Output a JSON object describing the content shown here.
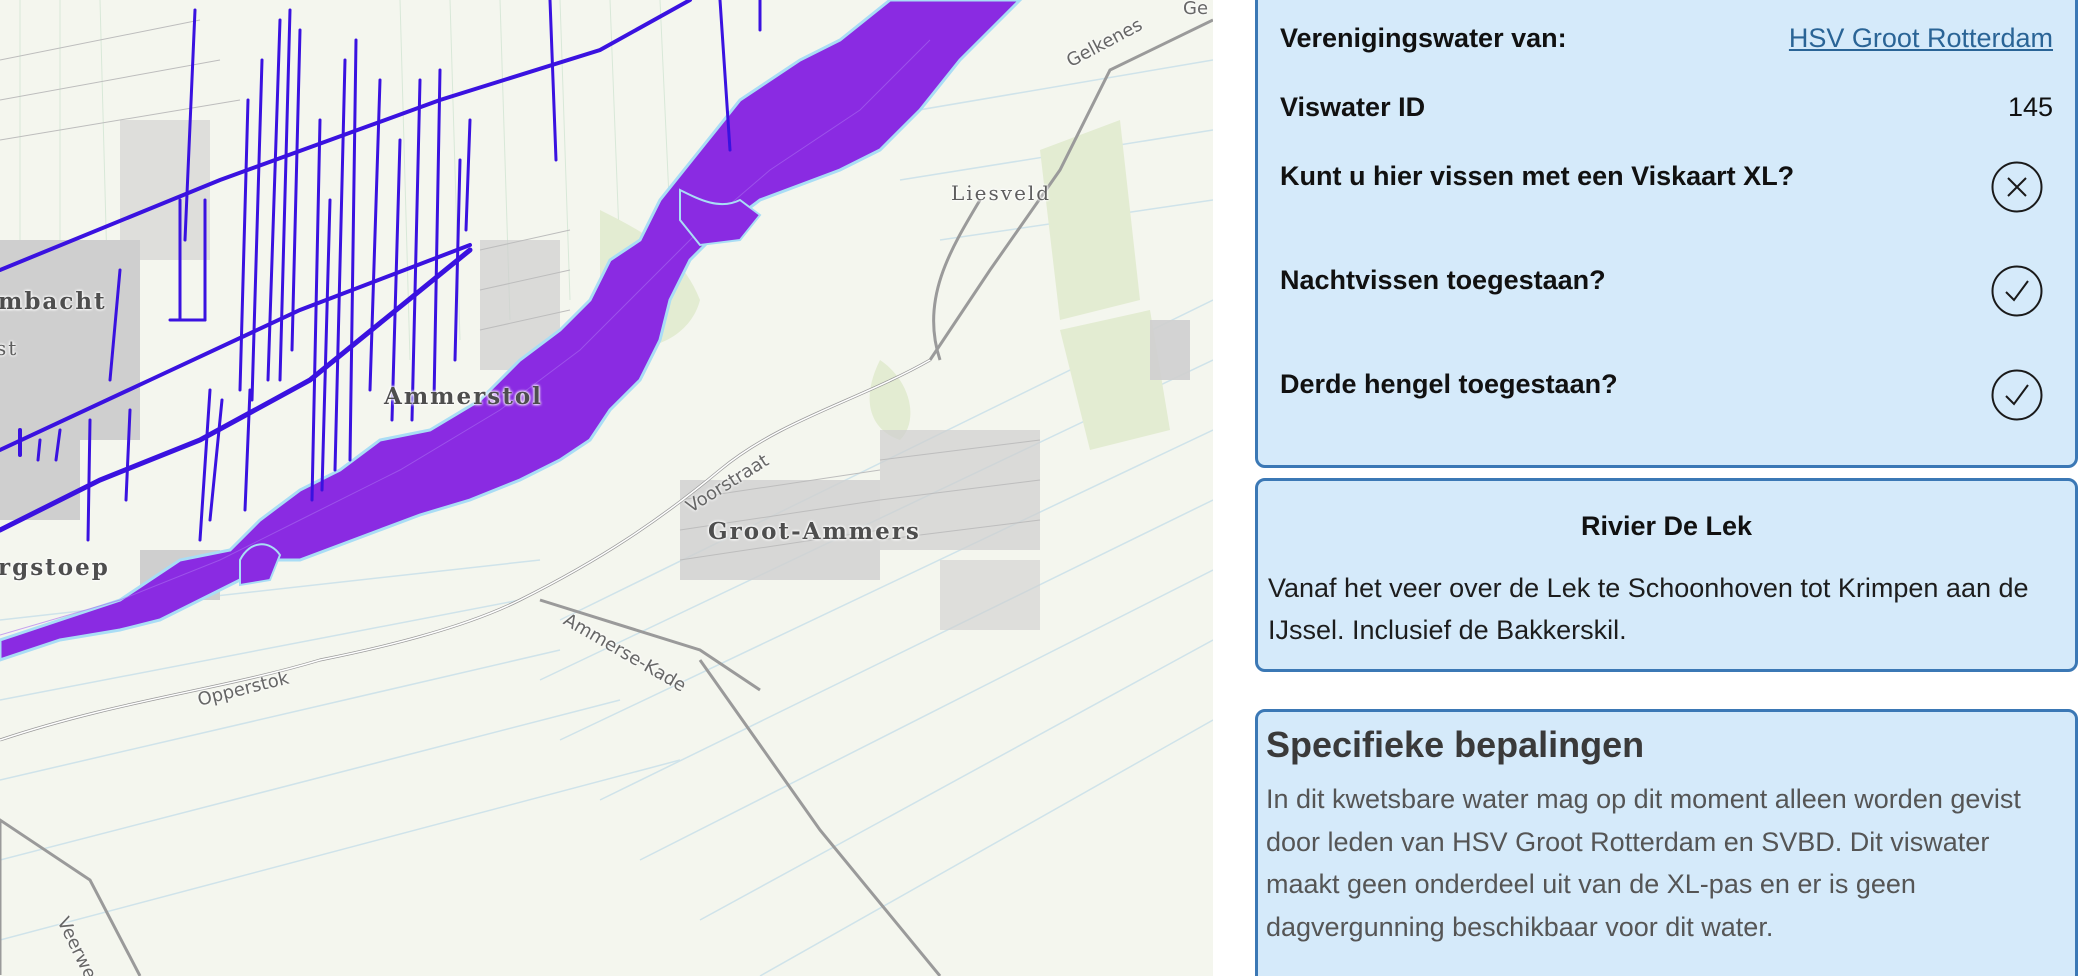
{
  "map": {
    "places": {
      "lekkerkerk_partial": "mbacht",
      "st_partial": "st",
      "ammerstol": "Ammerstol",
      "groot_ammers": "Groot-Ammers",
      "liesveld": "Liesveld",
      "bergstoep_partial": "rgstoep"
    },
    "roads": {
      "gelkenes": "Gelkenes",
      "ge_partial": "Ge",
      "voorstraat": "Voorstraat",
      "ammerse_kade": "Ammerse-Kade",
      "opperstok": "Opperstok",
      "veerweg_partial": "Veerwe"
    },
    "colors": {
      "river": "#8a2be2",
      "ditches": "#3a12e0",
      "land": "#f4f6ee"
    }
  },
  "info": {
    "association_label": "Verenigingswater van:",
    "association_value": "HSV Groot Rotterdam",
    "id_label": "Viswater ID",
    "id_value": "145",
    "xl_label": "Kunt u hier vissen met een Viskaart XL?",
    "xl_icon": "x-circle-icon",
    "night_label": "Nachtvissen toegestaan?",
    "night_icon": "check-circle-icon",
    "third_label": "Derde hengel toegestaan?",
    "third_icon": "check-circle-icon"
  },
  "water": {
    "title": "Rivier De Lek",
    "description": "Vanaf het veer over de Lek te Schoonhoven tot Krimpen aan de IJssel. Inclusief de Bakkerskil."
  },
  "rules": {
    "title": "Specifieke bepalingen",
    "text": "In dit kwetsbare water mag op dit moment alleen worden gevist door leden van HSV Groot Rotterdam en SVBD. Dit viswater maakt geen onderdeel uit van de XL-pas en er is geen dagvergunning beschikbaar voor dit water."
  }
}
